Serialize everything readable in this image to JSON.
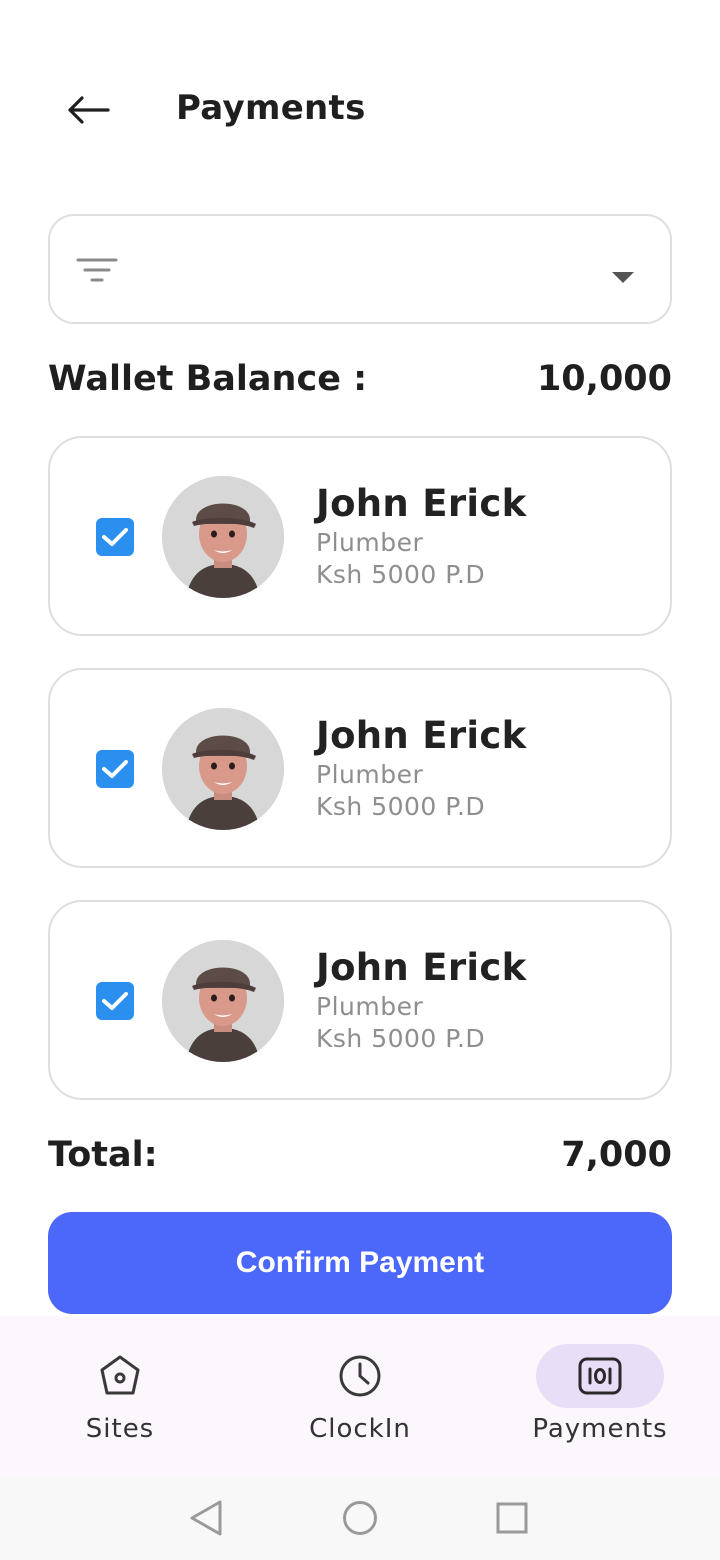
{
  "header": {
    "title": "Payments"
  },
  "filter": {
    "selected": ""
  },
  "wallet": {
    "label": "Wallet Balance :",
    "value": "10,000"
  },
  "workers": [
    {
      "name": "John Erick",
      "role": "Plumber",
      "rate": "Ksh 5000 P.D",
      "checked": true
    },
    {
      "name": "John Erick",
      "role": "Plumber",
      "rate": "Ksh 5000 P.D",
      "checked": true
    },
    {
      "name": "John Erick",
      "role": "Plumber",
      "rate": "Ksh 5000 P.D",
      "checked": true
    }
  ],
  "total": {
    "label": "Total:",
    "value": "7,000"
  },
  "confirm_button": {
    "label": "Confirm Payment"
  },
  "bottom_nav": {
    "items": [
      {
        "label": "Sites",
        "icon": "home-icon",
        "active": false
      },
      {
        "label": "ClockIn",
        "icon": "clock-icon",
        "active": false
      },
      {
        "label": "Payments",
        "icon": "payments-icon",
        "active": true
      }
    ]
  },
  "colors": {
    "primary": "#4c68fb",
    "checkbox": "#2b8ff0",
    "active_nav_bg": "#e8def8"
  }
}
